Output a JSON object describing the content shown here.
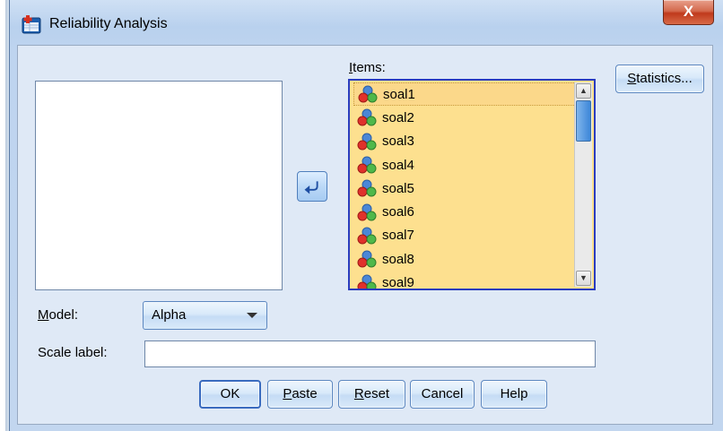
{
  "window": {
    "title": "Reliability Analysis",
    "close_label": "X"
  },
  "items": {
    "label_prefix": "",
    "label_mnemonic": "I",
    "label_rest": "tems:",
    "list": [
      "soal1",
      "soal2",
      "soal3",
      "soal4",
      "soal5",
      "soal6",
      "soal7",
      "soal8",
      "soal9"
    ],
    "selected": "soal1"
  },
  "buttons": {
    "statistics": {
      "mnemonic": "S",
      "rest": "tatistics..."
    },
    "ok": "OK",
    "paste": {
      "mnemonic": "P",
      "rest": "aste"
    },
    "reset": {
      "mnemonic": "R",
      "rest": "eset"
    },
    "cancel": "Cancel",
    "help": "Help"
  },
  "model": {
    "label_mnemonic": "M",
    "label_rest": "odel:",
    "value": "Alpha"
  },
  "scale_label": {
    "label": "Scale label:",
    "value": ""
  },
  "icons": {
    "title": "spss-dialog-icon",
    "move": "left-arrow-icon",
    "variable": "scale-variable-icon"
  }
}
